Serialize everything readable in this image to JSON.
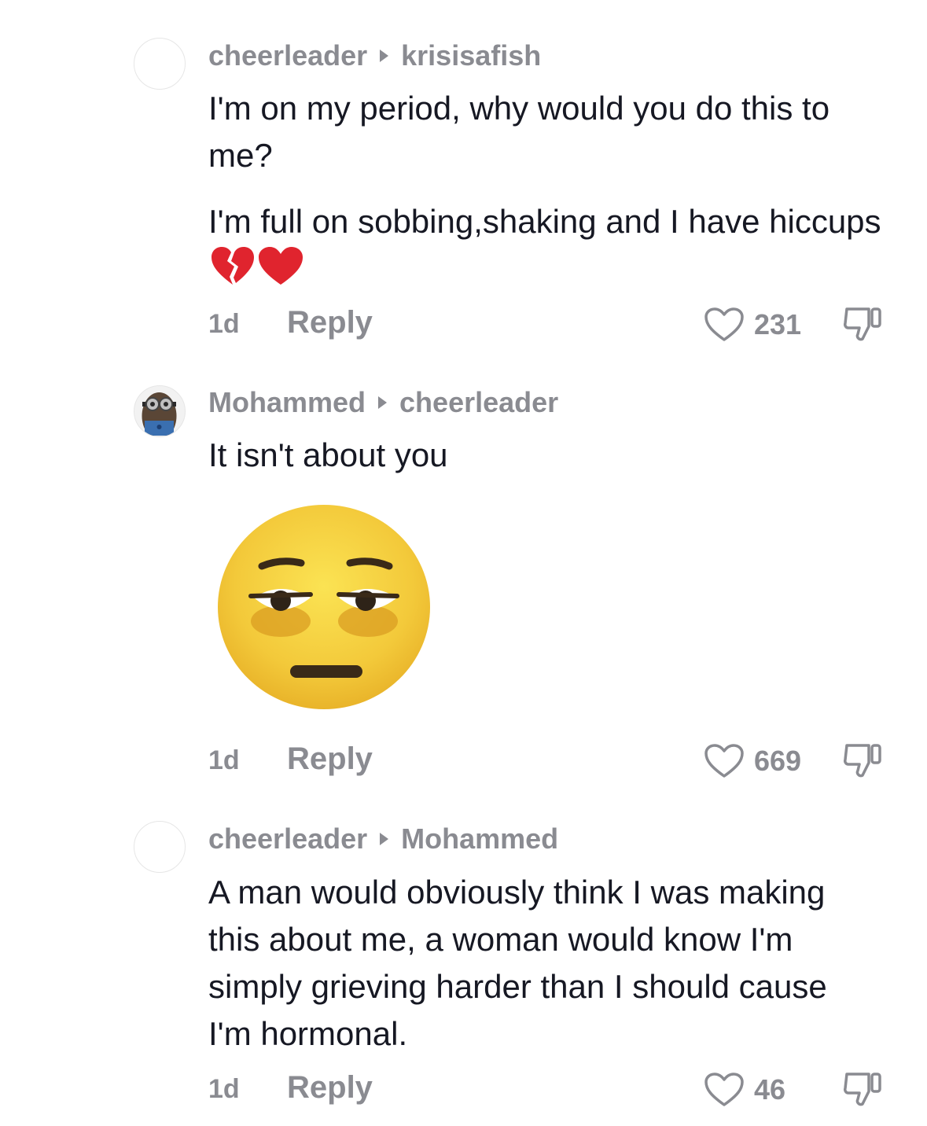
{
  "comments": [
    {
      "author": "cheerleader",
      "reply_to": "krisisafish",
      "paragraphs": [
        "I'm on my period, why would you do this to me?",
        "I'm full on sobbing,shaking and I have hiccups"
      ],
      "trailing_emojis": [
        "broken-heart-emoji",
        "red-heart-emoji"
      ],
      "time": "1d",
      "reply_label": "Reply",
      "likes": "231"
    },
    {
      "author": "Mohammed",
      "reply_to": "cheerleader",
      "paragraphs": [
        "It isn't about you"
      ],
      "sticker": "unamused-face-emoji",
      "time": "1d",
      "reply_label": "Reply",
      "likes": "669"
    },
    {
      "author": "cheerleader",
      "reply_to": "Mohammed",
      "paragraphs": [
        "A man would obviously think I was making this about me, a woman would know I'm simply grieving harder than I should cause I'm hormonal."
      ],
      "time": "1d",
      "reply_label": "Reply",
      "likes": "46"
    }
  ],
  "colors": {
    "text": "#161823",
    "muted": "#8a8b91",
    "heart_red": "#e0242e",
    "emoji_yellow": "#f5cf3a"
  }
}
